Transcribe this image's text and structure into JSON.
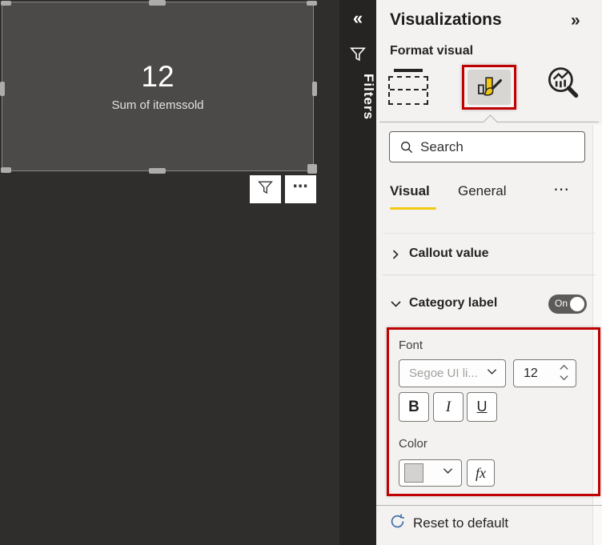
{
  "canvas": {
    "card": {
      "value": "12",
      "label": "Sum of itemssold"
    }
  },
  "visual_actions": {
    "more_label": "⋯"
  },
  "filters_bar": {
    "collapse_icon": "«",
    "title": "Filters"
  },
  "viz_pane": {
    "title": "Visualizations",
    "collapse_icon": "»",
    "subtitle": "Format visual",
    "toolbar_icons": [
      "build-visual",
      "format-visual",
      "analytics"
    ],
    "selected_icon": "format-visual",
    "search_placeholder": "Search",
    "tabs": {
      "visual": "Visual",
      "general": "General",
      "more": "⋯"
    },
    "sections": {
      "callout": {
        "label": "Callout value",
        "expanded": false
      },
      "category": {
        "label": "Category label",
        "expanded": true,
        "toggle_state": "On"
      }
    },
    "font_group": {
      "label": "Font",
      "font_family_value": "Segoe UI li...",
      "font_size_value": "12",
      "bold_label": "B",
      "italic_label": "I",
      "underline_label": "U"
    },
    "color_group": {
      "label": "Color",
      "fx_label": "fx"
    },
    "reset_label": "Reset to default"
  },
  "colors": {
    "accent_yellow": "#f2c811",
    "annotation_red": "#c00000",
    "canvas_bg": "#2f2e2d",
    "card_bg": "#4b4a48",
    "filters_bar_bg": "#252423",
    "pane_bg": "#f3f2f1",
    "toggle_bg": "#5d5b59",
    "reset_icon_blue": "#3f6fa8"
  }
}
